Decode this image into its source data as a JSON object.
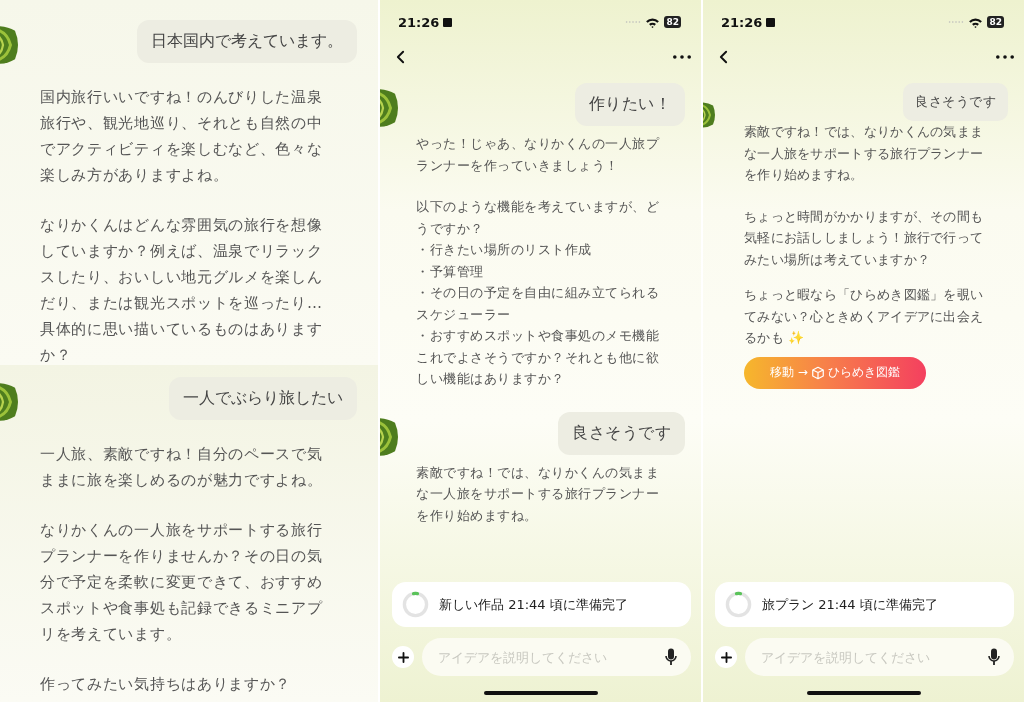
{
  "panels": [
    {
      "kind": "excerpt",
      "sections": [
        {
          "messages": [
            {
              "kind": "user",
              "text": "日本国内で考えています。"
            },
            {
              "kind": "assistant",
              "paragraphs": [
                "国内旅行いいですね！のんびりした温泉旅行や、観光地巡り、それとも自然の中でアクティビティを楽しむなど、色々な楽しみ方がありますよね。",
                "なりかくんはどんな雰囲気の旅行を想像していますか？例えば、温泉でリラックスしたり、おいしい地元グルメを楽しんだり、または観光スポットを巡ったり…具体的に思い描いているものはありますか？"
              ]
            }
          ]
        },
        {
          "messages": [
            {
              "kind": "user",
              "text": "一人でぶらり旅したい"
            },
            {
              "kind": "assistant",
              "paragraphs": [
                "一人旅、素敵ですね！自分のペースで気ままに旅を楽しめるのが魅力ですよね。",
                "なりかくんの一人旅をサポートする旅行プランナーを作りませんか？その日の気分で予定を柔軟に変更できて、おすすめスポットや食事処も記録できるミニアプリを考えています。",
                "作ってみたい気持ちはありますか？"
              ]
            }
          ]
        }
      ]
    },
    {
      "kind": "phone",
      "status_bar": {
        "time": "21:26",
        "battery": "82"
      },
      "messages": [
        {
          "kind": "user",
          "text": "作りたい！"
        },
        {
          "kind": "assistant",
          "paragraphs": [
            "やった！じゃあ、なりかくんの一人旅プランナーを作っていきましょう！",
            "以下のような機能を考えていますが、どうですか？",
            {
              "kind": "bullet",
              "text": "・行きたい場所のリスト作成"
            },
            {
              "kind": "bullet",
              "text": "・予算管理"
            },
            {
              "kind": "bullet",
              "text": "・その日の予定を自由に組み立てられるスケジューラー"
            },
            {
              "kind": "bullet",
              "text": "・おすすめスポットや食事処のメモ機能"
            },
            "これでよさそうですか？それとも他に欲しい機能はありますか？"
          ]
        },
        {
          "kind": "user",
          "text": "良さそうです"
        },
        {
          "kind": "assistant",
          "paragraphs": [
            "素敵ですね！では、なりかくんの気ままな一人旅をサポートする旅行プランナーを作り始めますね。"
          ]
        }
      ],
      "progress_card": {
        "text": "新しい作品 21:44 頃に準備完了"
      },
      "input": {
        "placeholder": "アイデアを説明してください"
      }
    },
    {
      "kind": "phone",
      "status_bar": {
        "time": "21:26",
        "battery": "82"
      },
      "messages": [
        {
          "kind": "user",
          "text": "良さそうです"
        },
        {
          "kind": "assistant",
          "paragraphs": [
            "素敵ですね！では、なりかくんの気ままな一人旅をサポートする旅行プランナーを作り始めますね。",
            "ちょっと時間がかかりますが、その間も気軽にお話ししましょう！旅行で行ってみたい場所は考えていますか？"
          ]
        },
        {
          "kind": "assistant",
          "paragraphs": [
            "ちょっと暇なら「ひらめき図鑑」を覗いてみない？心ときめくアイデアに出会えるかも ✨"
          ],
          "link_button": {
            "prefix": "移動 →",
            "label": "ひらめき図鑑"
          }
        }
      ],
      "progress_card": {
        "text": "旅プラン 21:44 頃に準備完了"
      },
      "input": {
        "placeholder": "アイデアを説明してください"
      }
    }
  ]
}
